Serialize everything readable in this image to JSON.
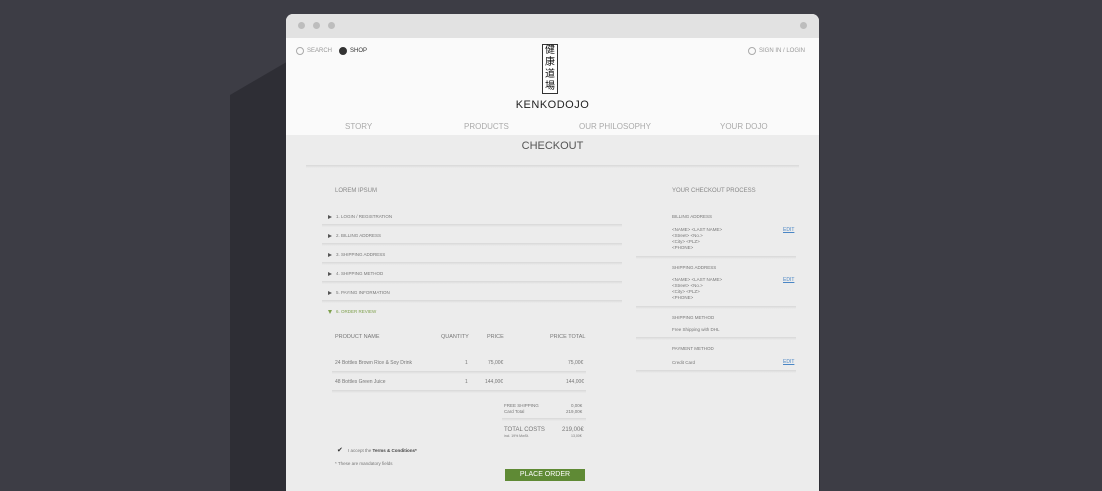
{
  "header": {
    "search_label": "SEARCH",
    "shop_label": "SHOP",
    "signin_label": "SIGN IN / LOGIN",
    "logo_chars": [
      "健",
      "康",
      "道",
      "場"
    ],
    "brand": "KENKODOJO"
  },
  "nav": {
    "items": [
      "STORY",
      "PRODUCTS",
      "OUR PHILOSOPHY",
      "YOUR DOJO"
    ]
  },
  "checkout": {
    "title": "CHECKOUT",
    "section_title": "LOREM IPSUM",
    "steps": [
      "1. LOGIN / REGISTRATION",
      "2. BILLING ADDRESS",
      "3. SHIPPING ADDRESS",
      "4. SHIPPING METHOD",
      "5. PAYING INFORMATION",
      "6. ORDER REVIEW"
    ],
    "table": {
      "headers": [
        "PRODUCT NAME",
        "QUANTITY",
        "PRICE",
        "PRICE TOTAL"
      ],
      "rows": [
        [
          "24 Bottles Brown Rice & Soy Drink",
          "1",
          "75,00€",
          "75,00€"
        ],
        [
          "48 Bottles Green Juice",
          "1",
          "144,00€",
          "144,00€"
        ]
      ]
    },
    "summary": {
      "free_shipping_label": "FREE SHIPPING",
      "free_shipping_value": "0,00€",
      "card_total_label": "Card Total",
      "card_total_value": "219,00€",
      "total_label": "TOTAL COSTS",
      "total_value": "219,00€",
      "vat_label": "incl. 19% MwSt.",
      "vat_value": "13,00€"
    },
    "terms_prefix": "I accept the",
    "terms_link": "Terms & Conditions*",
    "mandatory_note": "* These are mandatory fields",
    "place_order": "PLACE ORDER"
  },
  "sidebar": {
    "title": "YOUR CHECKOUT PROCESS",
    "billing_label": "BILLING ADDRESS",
    "billing_lines": [
      "<NAME> <LAST NAME>",
      "<Street> <No.>",
      "<City> <PLZ>",
      "<PHONE>"
    ],
    "shipping_label": "SHIPPING ADDRESS",
    "shipping_lines": [
      "<NAME> <LAST NAME>",
      "<Street> <No.>",
      "<City> <PLZ>",
      "<PHONE>"
    ],
    "method_label": "SHIPPING  METHOD",
    "method_value": "Free Shipping with DHL",
    "payment_label": "PAYMENT METHOD",
    "payment_value": "Credit Card",
    "edit_label": "EDIT"
  },
  "colors": {
    "background": "#3d3d45",
    "accent_green": "#5f8a35",
    "link_blue": "#4a86c5"
  }
}
